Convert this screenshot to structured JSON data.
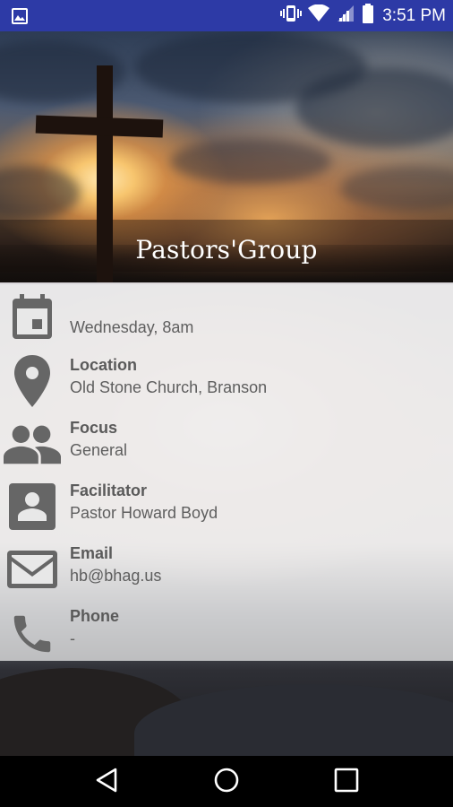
{
  "status_bar": {
    "time": "3:51 PM",
    "icons": [
      "image-icon",
      "vibrate-icon",
      "wifi-icon",
      "signal-icon",
      "battery-icon"
    ],
    "background": "#2d3aa6"
  },
  "hero": {
    "title": "Pastors'Group"
  },
  "details": {
    "schedule": {
      "label": "",
      "value": "Wednesday, 8am",
      "icon": "calendar-icon"
    },
    "location": {
      "label": "Location",
      "value": "Old Stone Church, Branson",
      "icon": "location-pin-icon"
    },
    "focus": {
      "label": "Focus",
      "value": "General",
      "icon": "people-icon"
    },
    "facilitator": {
      "label": "Facilitator",
      "value": "Pastor Howard Boyd",
      "icon": "contact-card-icon"
    },
    "email": {
      "label": "Email",
      "value": "hb@bhag.us",
      "icon": "mail-icon"
    },
    "phone": {
      "label": "Phone",
      "value": "-",
      "icon": "phone-icon"
    }
  },
  "colors": {
    "icon_gray": "#666666",
    "text_gray": "#5a5a5a",
    "card_background": "#ececec"
  },
  "nav_bar": {
    "buttons": [
      "back-icon",
      "home-icon",
      "recents-icon"
    ]
  }
}
